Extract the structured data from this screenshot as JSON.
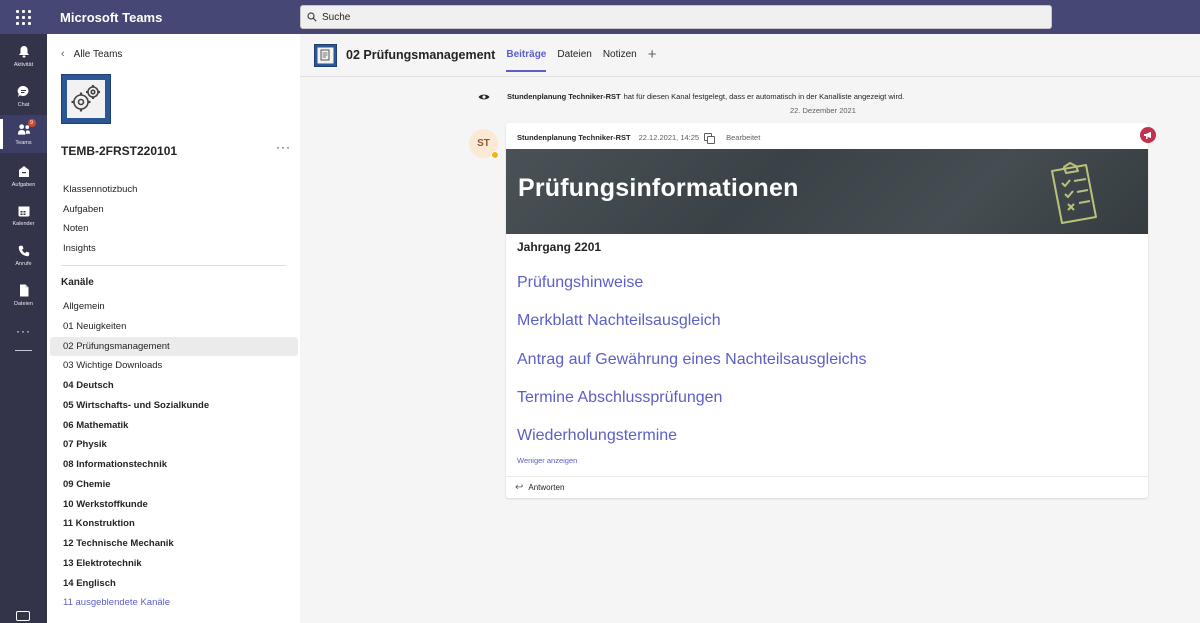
{
  "app": {
    "title": "Microsoft Teams"
  },
  "search": {
    "placeholder": "Suche"
  },
  "rail": {
    "items": [
      {
        "label": "Aktivität",
        "icon": "bell-icon"
      },
      {
        "label": "Chat",
        "icon": "chat-icon"
      },
      {
        "label": "Teams",
        "icon": "teams-icon",
        "badge": "9"
      },
      {
        "label": "Aufgaben",
        "icon": "assignments-icon"
      },
      {
        "label": "Kalender",
        "icon": "calendar-icon"
      },
      {
        "label": "Anrufe",
        "icon": "phone-icon"
      },
      {
        "label": "Dateien",
        "icon": "file-icon"
      }
    ],
    "more": "···"
  },
  "sidebar": {
    "back_label": "Alle Teams",
    "team_name": "TEMB-2FRST220101",
    "more": "···",
    "team_links": [
      "Klassennotizbuch",
      "Aufgaben",
      "Noten",
      "Insights"
    ],
    "channels_heading": "Kanäle",
    "channels": [
      {
        "label": "Allgemein",
        "bold": false
      },
      {
        "label": "01 Neuigkeiten",
        "bold": false
      },
      {
        "label": "02 Prüfungsmanagement",
        "bold": false,
        "selected": true
      },
      {
        "label": "03 Wichtige Downloads",
        "bold": false
      },
      {
        "label": "04 Deutsch",
        "bold": true
      },
      {
        "label": "05 Wirtschafts- und Sozialkunde",
        "bold": true
      },
      {
        "label": "06 Mathematik",
        "bold": true
      },
      {
        "label": "07 Physik",
        "bold": true
      },
      {
        "label": "08 Informationstechnik",
        "bold": true
      },
      {
        "label": "09 Chemie",
        "bold": true
      },
      {
        "label": "10 Werkstoffkunde",
        "bold": true
      },
      {
        "label": "11 Konstruktion",
        "bold": true
      },
      {
        "label": "12 Technische Mechanik",
        "bold": true
      },
      {
        "label": "13 Elektrotechnik",
        "bold": true
      },
      {
        "label": "14 Englisch",
        "bold": true
      }
    ],
    "hidden_channels": "11 ausgeblendete Kanäle"
  },
  "channel": {
    "title": "02 Prüfungsmanagement",
    "tabs": [
      "Beiträge",
      "Dateien",
      "Notizen"
    ],
    "active_tab": "Beiträge",
    "add_tab": "+"
  },
  "system_message": {
    "author": "Stundenplanung Techniker-RST",
    "text": "hat für diesen Kanal festgelegt, dass er automatisch in der Kanalliste angezeigt wird.",
    "date": "22. Dezember 2021"
  },
  "post": {
    "avatar_initials": "ST",
    "author": "Stundenplanung Techniker-RST",
    "timestamp": "22.12.2021, 14:25",
    "edited": "Bearbeitet",
    "banner_title": "Prüfungsinformationen",
    "subtitle": "Jahrgang 2201",
    "links": [
      "Prüfungshinweise",
      "Merkblatt Nachteilsausgleich",
      "Antrag auf Gewährung eines Nachteilsausgleichs",
      "Termine Abschlussprüfungen",
      "Wiederholungstermine"
    ],
    "show_less": "Weniger anzeigen",
    "reply": "Antworten"
  },
  "colors": {
    "topbar": "#464775",
    "rail": "#33344a",
    "accent": "#5b5fc7",
    "team_avatar": "#2b5797",
    "announcement": "#c4314b"
  }
}
